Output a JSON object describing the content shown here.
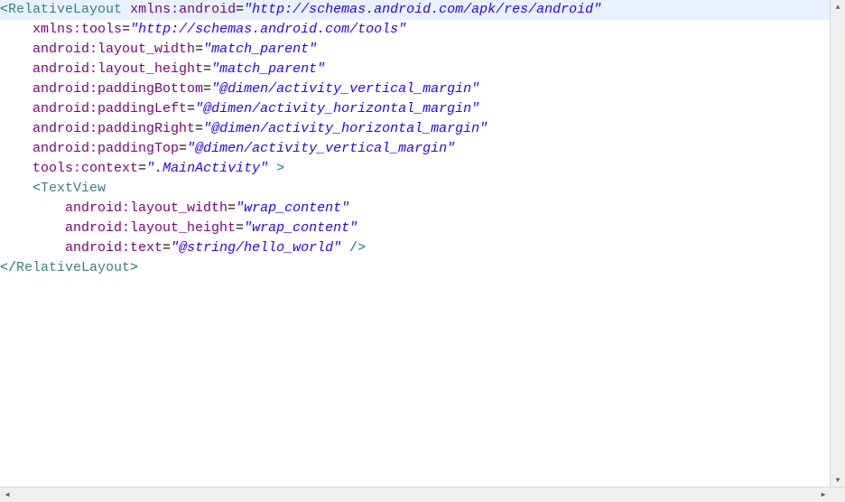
{
  "code": {
    "line1": {
      "tag_open": "<",
      "tag_name": "RelativeLayout",
      "attr": "xmlns:android",
      "eq": "=",
      "q1": "\"",
      "val": "http://schemas.android.com/apk/res/android",
      "q2": "\""
    },
    "line2": {
      "indent": "    ",
      "attr": "xmlns:tools",
      "eq": "=",
      "q1": "\"",
      "val": "http://schemas.android.com/tools",
      "q2": "\""
    },
    "line3": {
      "indent": "    ",
      "attr": "android:layout_width",
      "eq": "=",
      "q1": "\"",
      "val": "match_parent",
      "q2": "\""
    },
    "line4": {
      "indent": "    ",
      "attr": "android:layout_height",
      "eq": "=",
      "q1": "\"",
      "val": "match_parent",
      "q2": "\""
    },
    "line5": {
      "indent": "    ",
      "attr": "android:paddingBottom",
      "eq": "=",
      "q1": "\"",
      "val": "@dimen/activity_vertical_margin",
      "q2": "\""
    },
    "line6": {
      "indent": "    ",
      "attr": "android:paddingLeft",
      "eq": "=",
      "q1": "\"",
      "val": "@dimen/activity_horizontal_margin",
      "q2": "\""
    },
    "line7": {
      "indent": "    ",
      "attr": "android:paddingRight",
      "eq": "=",
      "q1": "\"",
      "val": "@dimen/activity_horizontal_margin",
      "q2": "\""
    },
    "line8": {
      "indent": "    ",
      "attr": "android:paddingTop",
      "eq": "=",
      "q1": "\"",
      "val": "@dimen/activity_vertical_margin",
      "q2": "\""
    },
    "line9": {
      "indent": "    ",
      "attr": "tools:context",
      "eq": "=",
      "q1": "\"",
      "val": ".MainActivity",
      "q2": "\"",
      "sp": " ",
      "close": ">"
    },
    "line10": "",
    "line11": {
      "indent": "    ",
      "open": "<",
      "tag": "TextView"
    },
    "line12": {
      "indent": "        ",
      "attr": "android:layout_width",
      "eq": "=",
      "q1": "\"",
      "val": "wrap_content",
      "q2": "\""
    },
    "line13": {
      "indent": "        ",
      "attr": "android:layout_height",
      "eq": "=",
      "q1": "\"",
      "val": "wrap_content",
      "q2": "\""
    },
    "line14": {
      "indent": "        ",
      "attr": "android:text",
      "eq": "=",
      "q1": "\"",
      "val": "@string/hello_world",
      "q2": "\"",
      "sp": " ",
      "close": "/>"
    },
    "line15": "",
    "line16": {
      "open": "</",
      "tag": "RelativeLayout",
      "close": ">"
    }
  }
}
